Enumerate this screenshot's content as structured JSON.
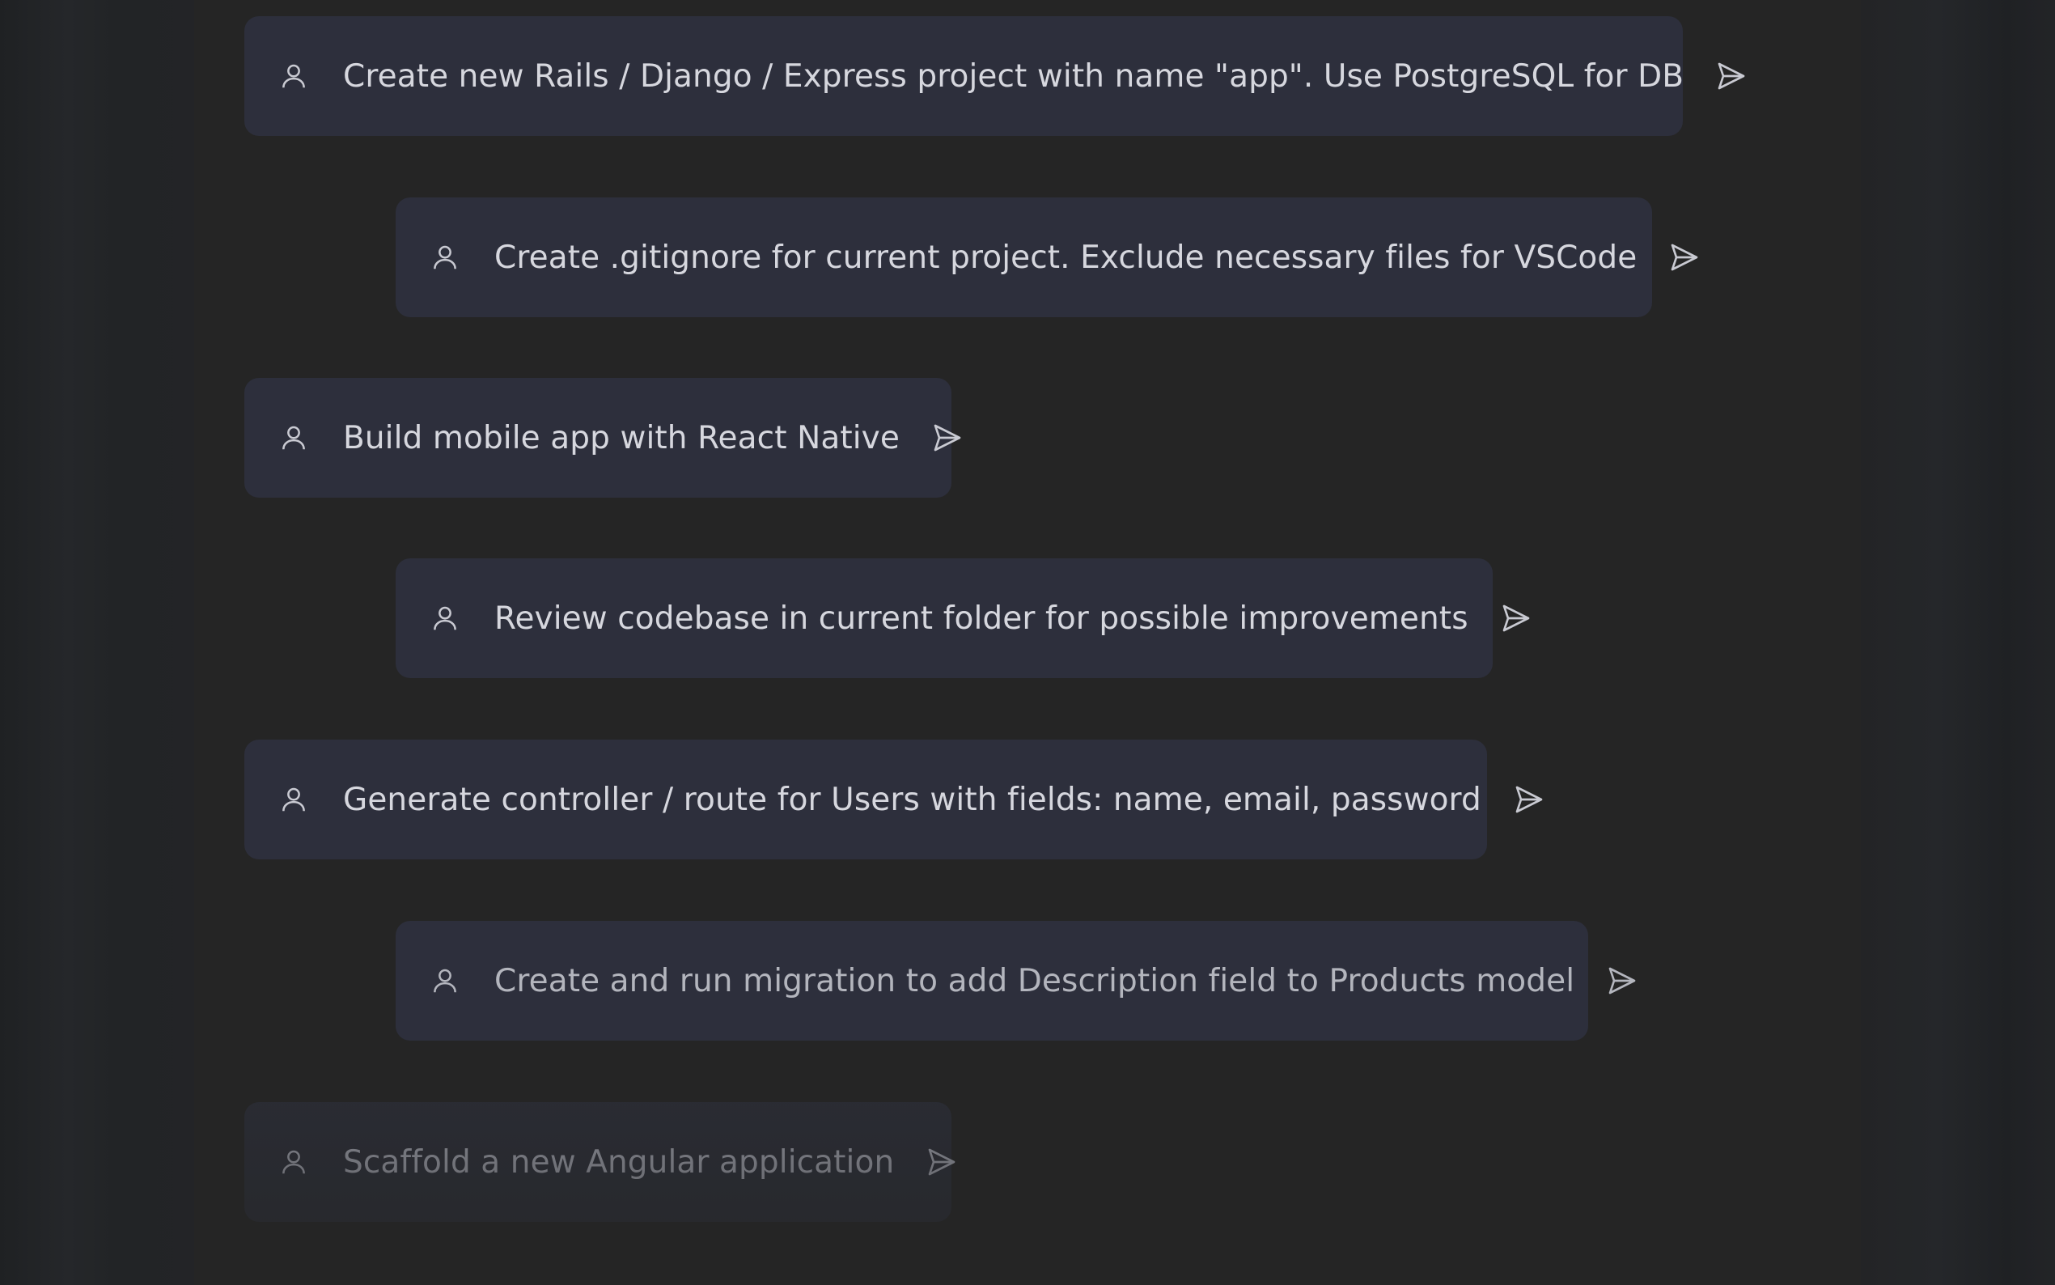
{
  "colors": {
    "background": "#262627",
    "card": "#2d2f3c",
    "text": "#d6d7de"
  },
  "prompts": [
    {
      "label": "Create new Rails / Django / Express project with name \"app\". Use PostgreSQL for DB",
      "user_icon": "user-icon",
      "send_icon": "send-icon"
    },
    {
      "label": "Create .gitignore for current project. Exclude necessary files for VSCode",
      "user_icon": "user-icon",
      "send_icon": "send-icon"
    },
    {
      "label": "Build mobile app with React Native",
      "user_icon": "user-icon",
      "send_icon": "send-icon"
    },
    {
      "label": "Review codebase in current folder for possible improvements",
      "user_icon": "user-icon",
      "send_icon": "send-icon"
    },
    {
      "label": "Generate controller / route for Users with fields: name, email, password",
      "user_icon": "user-icon",
      "send_icon": "send-icon"
    },
    {
      "label": "Create and run migration to add Description field to Products model",
      "user_icon": "user-icon",
      "send_icon": "send-icon"
    },
    {
      "label": "Scaffold a new Angular application",
      "user_icon": "user-icon",
      "send_icon": "send-icon"
    }
  ]
}
